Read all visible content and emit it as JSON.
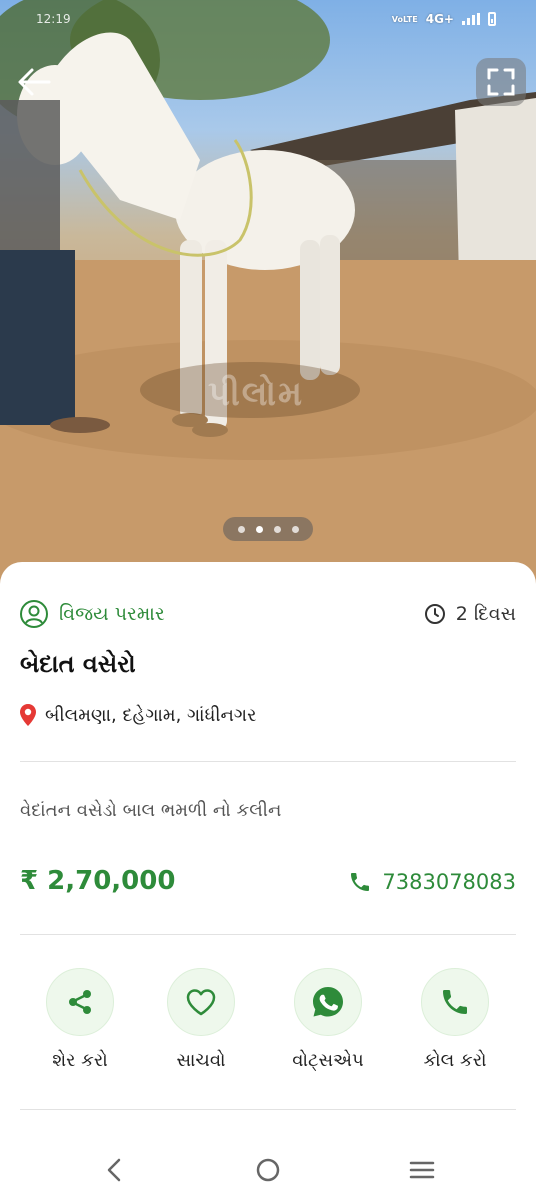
{
  "status_bar": {
    "left_text": "12:19",
    "network_label": "VoLTE",
    "network_type": "4G+"
  },
  "gallery": {
    "image_count": 4,
    "active_index": 1,
    "watermark": "પીલોમ"
  },
  "seller": {
    "name": "વિજય પરમાર",
    "icon": "user-circle-icon"
  },
  "posted": {
    "time": "2 દિવસ",
    "icon": "clock-icon"
  },
  "listing": {
    "title": "બેદાત વસેરો",
    "location": "બીલમણા, દહેગામ, ગાંધીનગર",
    "description": "વેદાંતન વસેડો બાલ ભમળી નો કલીન",
    "price": "₹ 2,70,000",
    "phone": "7383078083"
  },
  "actions": [
    {
      "label": "શેર કરો",
      "icon": "share-icon"
    },
    {
      "label": "સાચવો",
      "icon": "heart-icon"
    },
    {
      "label": "વોટ્સએપ",
      "icon": "whatsapp-icon"
    },
    {
      "label": "કોલ કરો",
      "icon": "phone-icon"
    }
  ],
  "colors": {
    "accent": "#2e8b3a",
    "action_bg": "#eef8ec",
    "location_pin": "#e53935"
  }
}
